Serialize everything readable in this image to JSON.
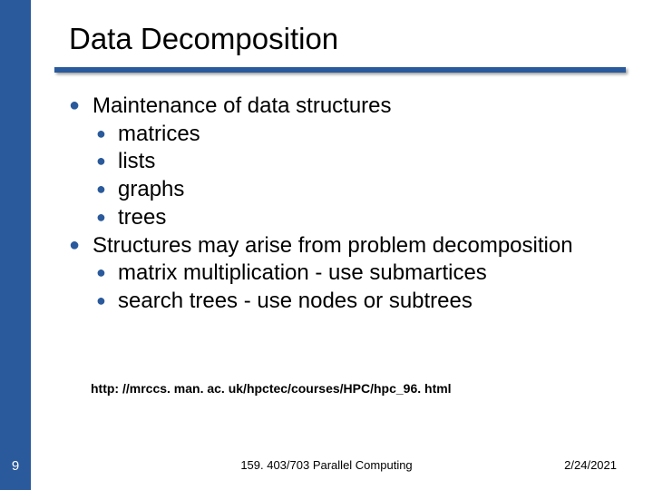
{
  "title": "Data Decomposition",
  "body": {
    "item1": {
      "text": "Maintenance of data structures",
      "sub": [
        "matrices",
        "lists",
        "graphs",
        "trees"
      ]
    },
    "item2": {
      "text": "Structures may arise from problem decomposition",
      "sub": [
        "matrix multiplication - use submartices",
        "search trees - use nodes or subtrees"
      ]
    }
  },
  "url": "http: //mrccs. man. ac. uk/hpctec/courses/HPC/hpc_96. html",
  "footer": {
    "slide_number": "9",
    "center": "159. 403/703 Parallel Computing",
    "date": "2/24/2021"
  },
  "colors": {
    "accent": "#2a5a9b"
  }
}
